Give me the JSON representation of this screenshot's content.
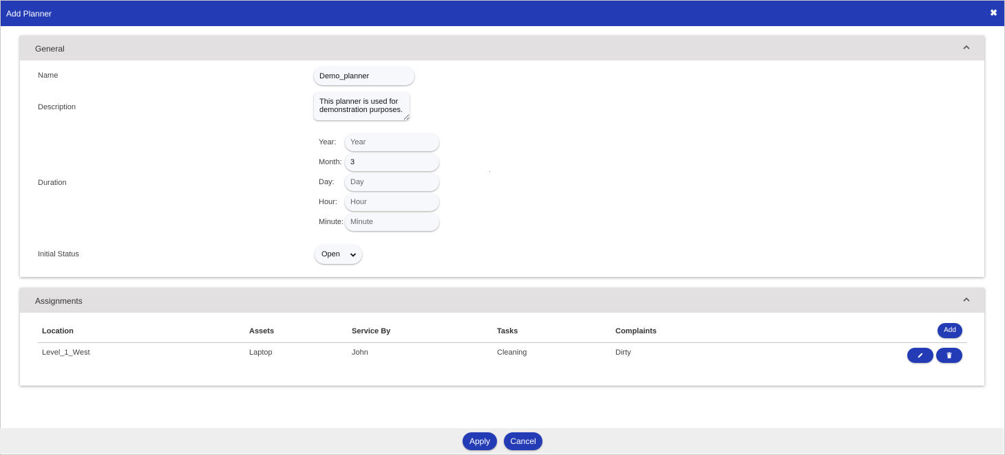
{
  "dialog": {
    "title": "Add Planner",
    "close_symbol": "✖"
  },
  "general": {
    "section_title": "General",
    "name": {
      "label": "Name",
      "value": "Demo_planner"
    },
    "description": {
      "label": "Description",
      "value": "This planner is used for demonstration purposes."
    },
    "duration": {
      "label": "Duration",
      "year": {
        "label": "Year:",
        "value": "",
        "placeholder": "Year"
      },
      "month": {
        "label": "Month:",
        "value": "3",
        "placeholder": "Month"
      },
      "day": {
        "label": "Day:",
        "value": "",
        "placeholder": "Day"
      },
      "hour": {
        "label": "Hour:",
        "value": "",
        "placeholder": "Hour"
      },
      "minute": {
        "label": "Minute:",
        "value": "",
        "placeholder": "Minute"
      }
    },
    "initial_status": {
      "label": "Initial Status",
      "selected": "Open"
    }
  },
  "assignments": {
    "section_title": "Assignments",
    "add_label": "Add",
    "columns": [
      "Location",
      "Assets",
      "Service By",
      "Tasks",
      "Complaints"
    ],
    "rows": [
      {
        "location": "Level_1_West",
        "assets": "Laptop",
        "service_by": "John",
        "tasks": "Cleaning",
        "complaints": "Dirty"
      }
    ]
  },
  "footer": {
    "apply_label": "Apply",
    "cancel_label": "Cancel"
  },
  "colors": {
    "accent": "#233bb5",
    "section_header": "#e2e0e0",
    "footer": "#eeeeee"
  },
  "icons": [
    "close-icon",
    "chevron-up-icon",
    "chevron-down-icon",
    "pencil-icon",
    "trash-icon"
  ]
}
